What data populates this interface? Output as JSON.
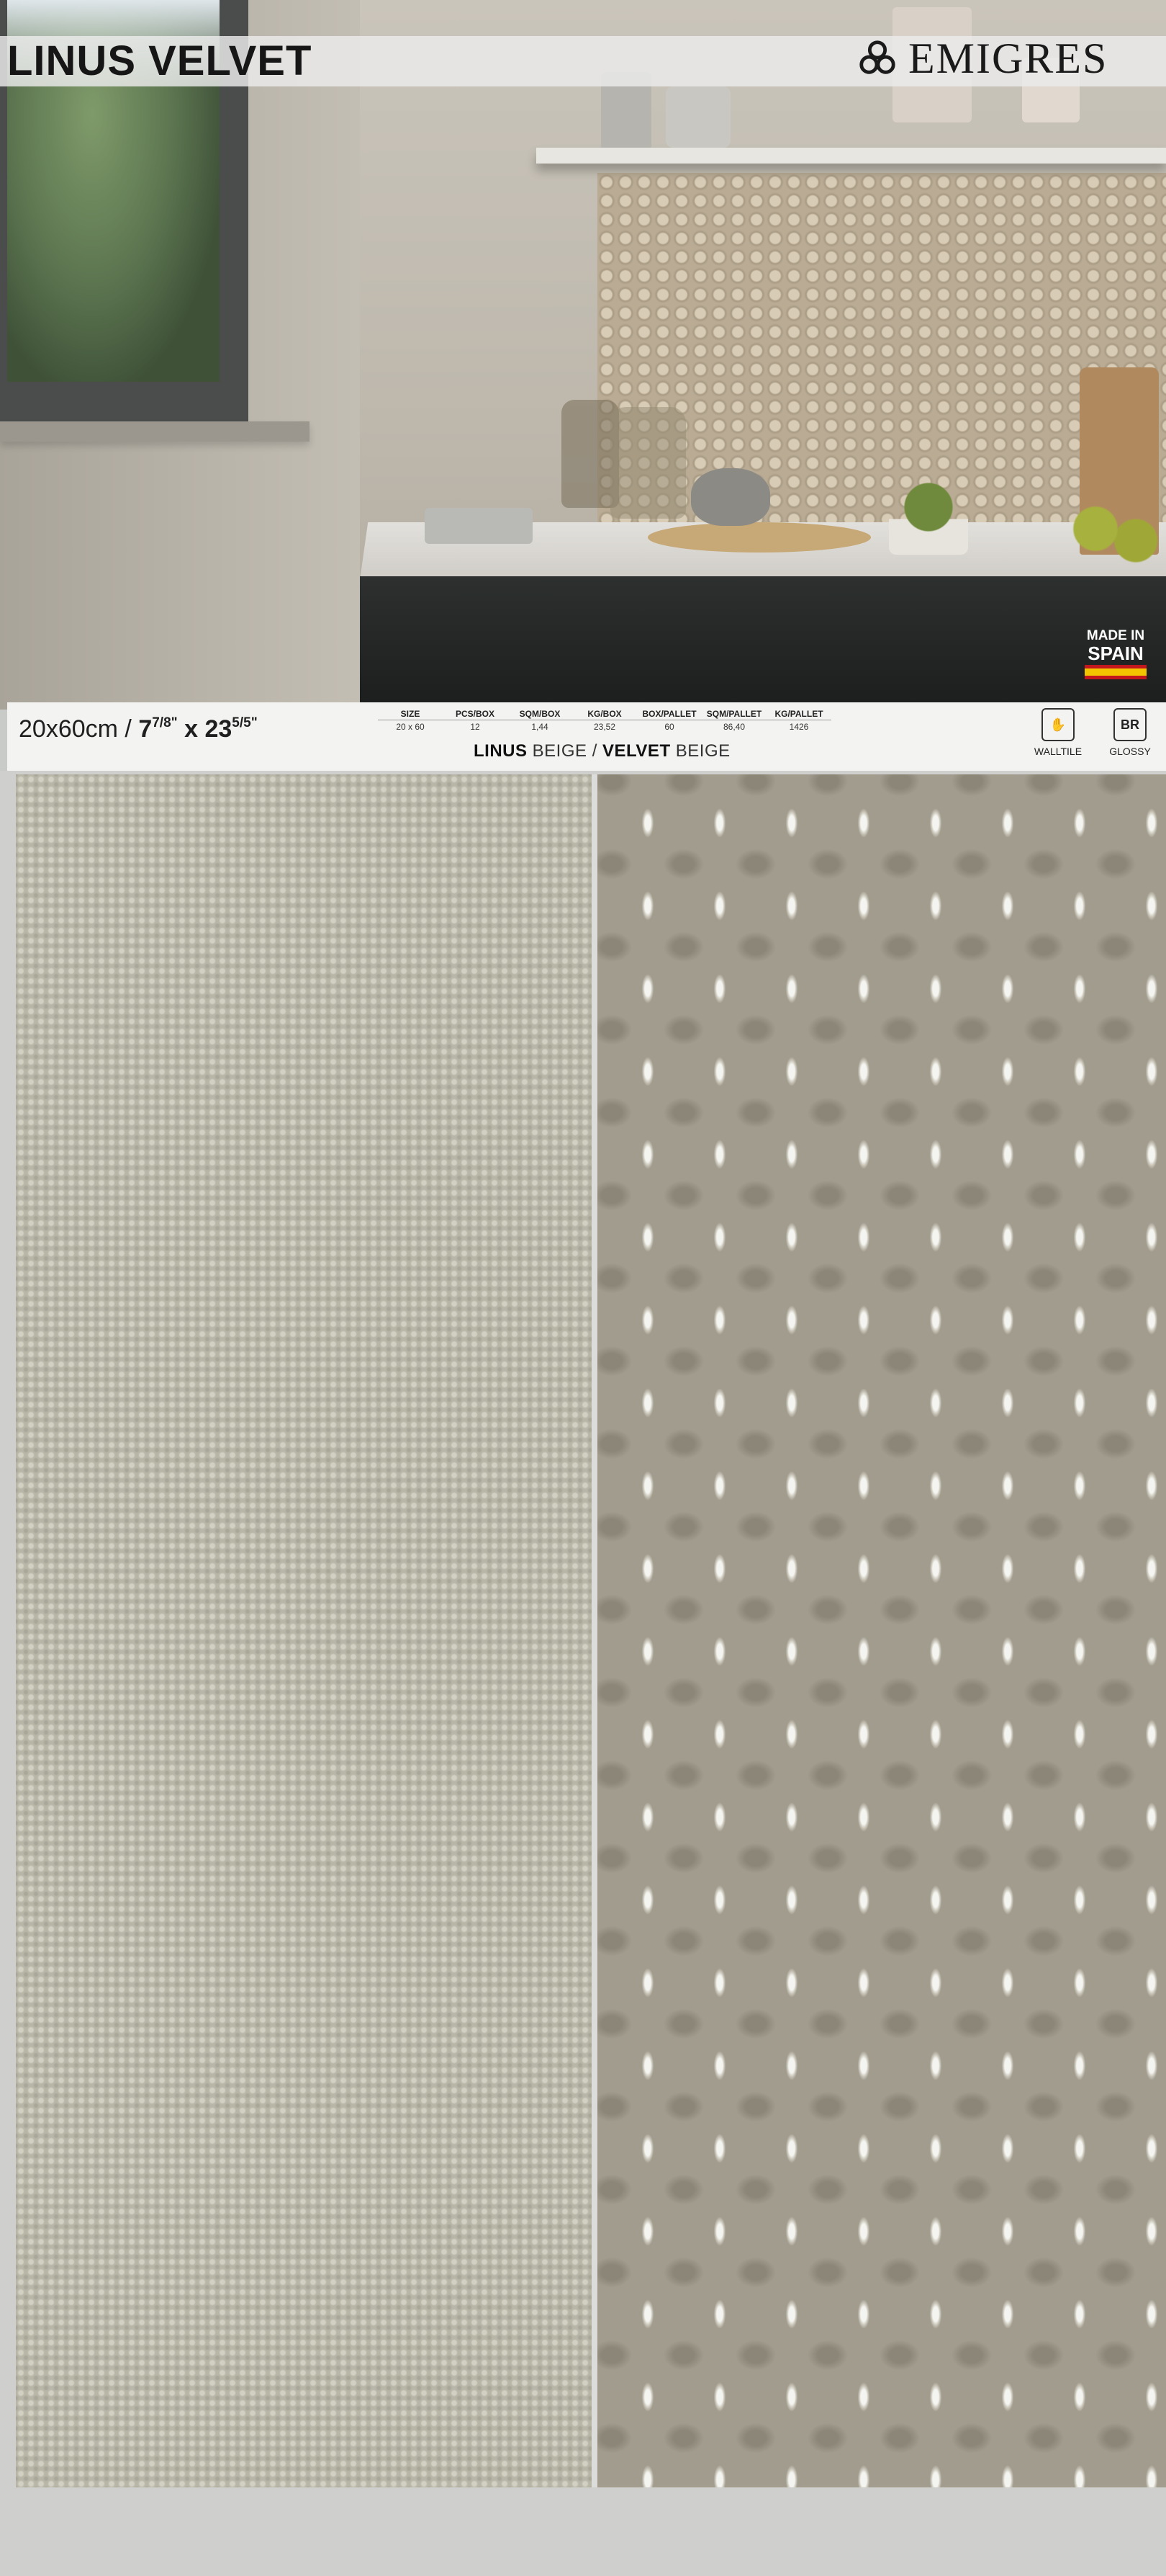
{
  "header": {
    "title": "LINUS VELVET",
    "brand": "EMIGRES"
  },
  "badge": {
    "made_in": "MADE IN",
    "country": "SPAIN"
  },
  "spec": {
    "size": "20x60cm / ",
    "size_inch_main1": "7",
    "size_inch_sup1": "7/8\"",
    "size_inch_x": " x ",
    "size_inch_main2": "23",
    "size_inch_sup2": "5/5\"",
    "columns": [
      "SIZE",
      "PCS/BOX",
      "SQM/BOX",
      "KG/BOX",
      "BOX/PALLET",
      "SQM/PALLET",
      "KG/PALLET"
    ],
    "values": [
      "20 x 60",
      "12",
      "1,44",
      "23,52",
      "60",
      "86,40",
      "1426"
    ],
    "series_1": "LINUS",
    "series_1_color": " BEIGE / ",
    "series_2": "VELVET",
    "series_2_color": " BEIGE",
    "icons": [
      {
        "symbol": "✋",
        "label": "WALLTILE"
      },
      {
        "symbol": "BR",
        "label": "GLOSSY"
      }
    ]
  }
}
